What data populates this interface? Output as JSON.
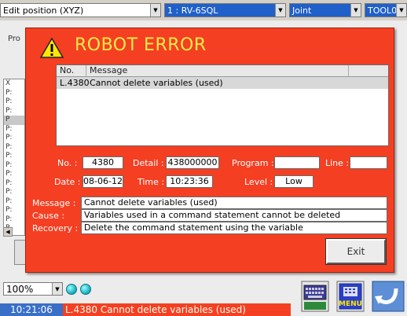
{
  "topbar": {
    "mode": "Edit position (XYZ)",
    "robot": "1 : RV-6SQL",
    "jog": "Joint",
    "tool": "TOOL0"
  },
  "background": {
    "pro_label": "Pro",
    "list_items": [
      "X",
      "P:",
      "P:",
      "P:",
      "P",
      "P:",
      "P:",
      "P:",
      "P:",
      "P:",
      "P:",
      "P:",
      "P:",
      "P:",
      "P:",
      "P:",
      "P"
    ]
  },
  "dialog": {
    "title": "ROBOT ERROR",
    "title_color": "#ffec4a",
    "bg_color": "#f53f22",
    "table": {
      "headers": [
        "No.",
        "Message"
      ],
      "rows": [
        {
          "no": "L.4380",
          "message": "Cannot delete variables (used)"
        }
      ]
    },
    "fields": {
      "no_label": "No. :",
      "no": "4380",
      "detail_label": "Detail :",
      "detail": "438000000",
      "program_label": "Program :",
      "program": "",
      "line_label": "Line :",
      "line": "",
      "date_label": "Date :",
      "date": "08-06-12",
      "time_label": "Time :",
      "time": "10:23:36",
      "level_label": "Level :",
      "level": "Low",
      "message_label": "Message :",
      "message": "Cannot delete variables (used)",
      "cause_label": "Cause :",
      "cause": "Variables used in a command statement cannot be deleted",
      "recovery_label": "Recovery :",
      "recovery": "Delete the command statement using the variable"
    },
    "exit_label": "Exit"
  },
  "bottom": {
    "zoom": "100%",
    "time": "10:21:06",
    "status_message": "L.4380 Cannot delete variables (used)",
    "status_error_color": "#f53f22",
    "time_bg_color": "#3a6fc8"
  },
  "icons": [
    "warning-icon",
    "chevron-down-icon",
    "keyboard-icon",
    "menu-icon",
    "back-arrow-icon"
  ]
}
